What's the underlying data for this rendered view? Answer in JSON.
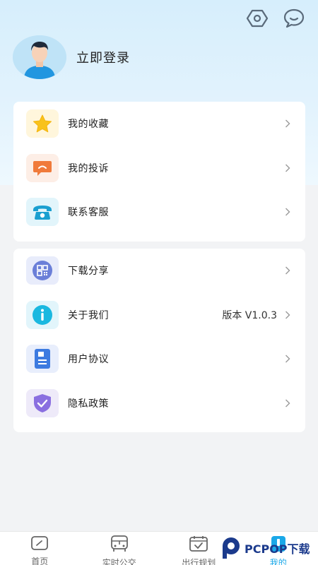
{
  "header": {
    "login_label": "立即登录"
  },
  "top_icons": [
    "settings-hex-icon",
    "message-icon"
  ],
  "menu_group1": [
    {
      "label": "我的收藏",
      "icon": "star-icon",
      "icon_bg": "#fff6dc"
    },
    {
      "label": "我的投诉",
      "icon": "complaint-icon",
      "icon_bg": "#fdeee6"
    },
    {
      "label": "联系客服",
      "icon": "phone-icon",
      "icon_bg": "#e2f5fb"
    }
  ],
  "menu_group2": [
    {
      "label": "下载分享",
      "icon": "qrcode-icon",
      "icon_bg": "#e8ecfb"
    },
    {
      "label": "关于我们",
      "value": "版本 V1.0.3",
      "icon": "info-icon",
      "icon_bg": "#e2f5fb"
    },
    {
      "label": "用户协议",
      "icon": "document-icon",
      "icon_bg": "#e8eefc"
    },
    {
      "label": "隐私政策",
      "icon": "shield-icon",
      "icon_bg": "#eeeaf9"
    }
  ],
  "bottom_nav": [
    {
      "label": "首页",
      "icon": "home-icon",
      "active": false
    },
    {
      "label": "实时公交",
      "icon": "bus-icon",
      "active": false
    },
    {
      "label": "出行规划",
      "icon": "calendar-check-icon",
      "active": false
    },
    {
      "label": "我的",
      "icon": "profile-icon",
      "active": true
    }
  ],
  "watermark": {
    "text": "PCPOP下载"
  },
  "colors": {
    "accent": "#1aa8e8",
    "hero_bg": "#d6eefc",
    "page_bg": "#f2f3f5"
  }
}
